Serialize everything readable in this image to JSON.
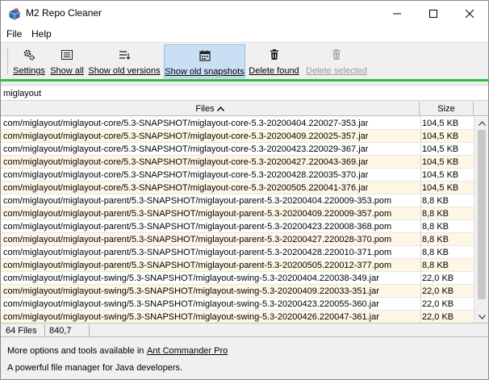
{
  "window": {
    "title": "M2 Repo Cleaner",
    "icons": {
      "app": "repo-cleaner-icon",
      "minimize": "minimize-icon",
      "maximize": "maximize-icon",
      "close": "close-icon"
    }
  },
  "menu": [
    {
      "label": "File"
    },
    {
      "label": "Help"
    }
  ],
  "toolbar": {
    "settings": {
      "label": "Settings",
      "icon": "gears-icon"
    },
    "show_all": {
      "label": "Show all",
      "icon": "list-icon"
    },
    "show_old_versions": {
      "label": "Show old versions",
      "icon": "filter-list-icon"
    },
    "show_old_snapshots": {
      "label": "Show old snapshots",
      "icon": "calendar-icon",
      "active": true
    },
    "delete_found": {
      "label": "Delete found",
      "icon": "trash-icon"
    },
    "delete_selected": {
      "label": "Delete selected",
      "icon": "trash-icon",
      "disabled": true
    }
  },
  "filter": {
    "value": "miglayout"
  },
  "table": {
    "columns": {
      "files": "Files",
      "size": "Size"
    },
    "sort": {
      "column": "Files",
      "direction": "ascending",
      "icon": "sort-up-icon"
    },
    "rows": [
      {
        "path": "com/miglayout/miglayout-core/5.3-SNAPSHOT/miglayout-core-5.3-20200404.220027-353.jar",
        "size": "104,5 KB"
      },
      {
        "path": "com/miglayout/miglayout-core/5.3-SNAPSHOT/miglayout-core-5.3-20200409.220025-357.jar",
        "size": "104,5 KB"
      },
      {
        "path": "com/miglayout/miglayout-core/5.3-SNAPSHOT/miglayout-core-5.3-20200423.220029-367.jar",
        "size": "104,5 KB"
      },
      {
        "path": "com/miglayout/miglayout-core/5.3-SNAPSHOT/miglayout-core-5.3-20200427.220043-369.jar",
        "size": "104,5 KB"
      },
      {
        "path": "com/miglayout/miglayout-core/5.3-SNAPSHOT/miglayout-core-5.3-20200428.220035-370.jar",
        "size": "104,5 KB"
      },
      {
        "path": "com/miglayout/miglayout-core/5.3-SNAPSHOT/miglayout-core-5.3-20200505.220041-376.jar",
        "size": "104,5 KB"
      },
      {
        "path": "com/miglayout/miglayout-parent/5.3-SNAPSHOT/miglayout-parent-5.3-20200404.220009-353.pom",
        "size": "8,8 KB"
      },
      {
        "path": "com/miglayout/miglayout-parent/5.3-SNAPSHOT/miglayout-parent-5.3-20200409.220009-357.pom",
        "size": "8,8 KB"
      },
      {
        "path": "com/miglayout/miglayout-parent/5.3-SNAPSHOT/miglayout-parent-5.3-20200423.220008-368.pom",
        "size": "8,8 KB"
      },
      {
        "path": "com/miglayout/miglayout-parent/5.3-SNAPSHOT/miglayout-parent-5.3-20200427.220028-370.pom",
        "size": "8,8 KB"
      },
      {
        "path": "com/miglayout/miglayout-parent/5.3-SNAPSHOT/miglayout-parent-5.3-20200428.220010-371.pom",
        "size": "8,8 KB"
      },
      {
        "path": "com/miglayout/miglayout-parent/5.3-SNAPSHOT/miglayout-parent-5.3-20200505.220012-377.pom",
        "size": "8,8 KB"
      },
      {
        "path": "com/miglayout/miglayout-swing/5.3-SNAPSHOT/miglayout-swing-5.3-20200404.220038-349.jar",
        "size": "22,0 KB"
      },
      {
        "path": "com/miglayout/miglayout-swing/5.3-SNAPSHOT/miglayout-swing-5.3-20200409.220033-351.jar",
        "size": "22,0 KB"
      },
      {
        "path": "com/miglayout/miglayout-swing/5.3-SNAPSHOT/miglayout-swing-5.3-20200423.220055-360.jar",
        "size": "22,0 KB"
      },
      {
        "path": "com/miglayout/miglayout-swing/5.3-SNAPSHOT/miglayout-swing-5.3-20200426.220047-361.jar",
        "size": "22,0 KB"
      }
    ]
  },
  "status": {
    "file_count": "64 Files",
    "total_size": "840,7 KB"
  },
  "promo": {
    "line1": "More options and tools available in",
    "link": "Ant Commander Pro",
    "line2": "A powerful file manager for Java developers."
  },
  "colors": {
    "accent_progress": "#2fbf47",
    "active_button": "#c9dff3",
    "row_alt": "#fff7e6"
  }
}
